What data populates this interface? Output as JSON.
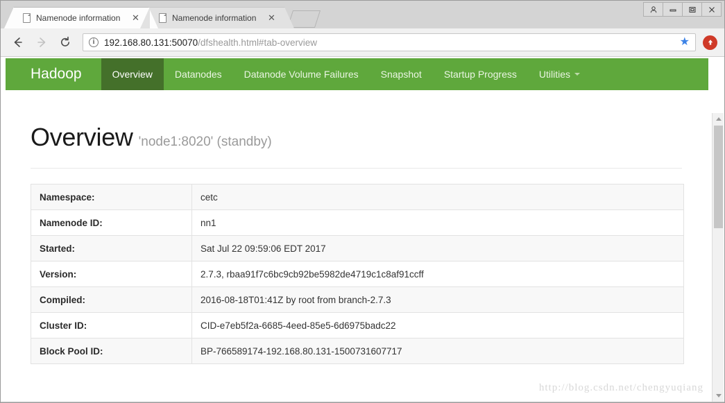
{
  "browser": {
    "tabs": [
      {
        "title": "Namenode information",
        "active": true,
        "close_label": "✕",
        "icon": "page-icon"
      },
      {
        "title": "Namenode information",
        "active": false,
        "close_label": "✕",
        "icon": "page-icon"
      }
    ],
    "new_tab_label": "",
    "window_controls": {
      "user": "user-icon",
      "minimize": "minimize-icon",
      "maximize": "maximize-icon",
      "close": "close-icon"
    },
    "toolbar": {
      "back_label": "←",
      "forward_label": "→",
      "reload_label": "⟳",
      "info_label": "i",
      "url_host": "192.168.80.131:50070",
      "url_path": "/dfshealth.html#tab-overview",
      "star_label": "★",
      "extension_label": "⬆"
    }
  },
  "navbar": {
    "brand": "Hadoop",
    "items": [
      {
        "label": "Overview",
        "active": true,
        "caret": false
      },
      {
        "label": "Datanodes",
        "active": false,
        "caret": false
      },
      {
        "label": "Datanode Volume Failures",
        "active": false,
        "caret": false
      },
      {
        "label": "Snapshot",
        "active": false,
        "caret": false
      },
      {
        "label": "Startup Progress",
        "active": false,
        "caret": false
      },
      {
        "label": "Utilities",
        "active": false,
        "caret": true
      }
    ],
    "colors": {
      "bar": "#5fa83c",
      "active": "#44702a",
      "text": "#ffffff"
    }
  },
  "page": {
    "title": "Overview",
    "subtitle": "'node1:8020' (standby)",
    "table": {
      "rows": [
        {
          "key": "Namespace:",
          "value": "cetc"
        },
        {
          "key": "Namenode ID:",
          "value": "nn1"
        },
        {
          "key": "Started:",
          "value": "Sat Jul 22 09:59:06 EDT 2017"
        },
        {
          "key": "Version:",
          "value": "2.7.3, rbaa91f7c6bc9cb92be5982de4719c1c8af91ccff"
        },
        {
          "key": "Compiled:",
          "value": "2016-08-18T01:41Z by root from branch-2.7.3"
        },
        {
          "key": "Cluster ID:",
          "value": "CID-e7eb5f2a-6685-4eed-85e5-6d6975badc22"
        },
        {
          "key": "Block Pool ID:",
          "value": "BP-766589174-192.168.80.131-1500731607717"
        }
      ]
    },
    "watermark": "http://blog.csdn.net/chengyuqiang"
  }
}
